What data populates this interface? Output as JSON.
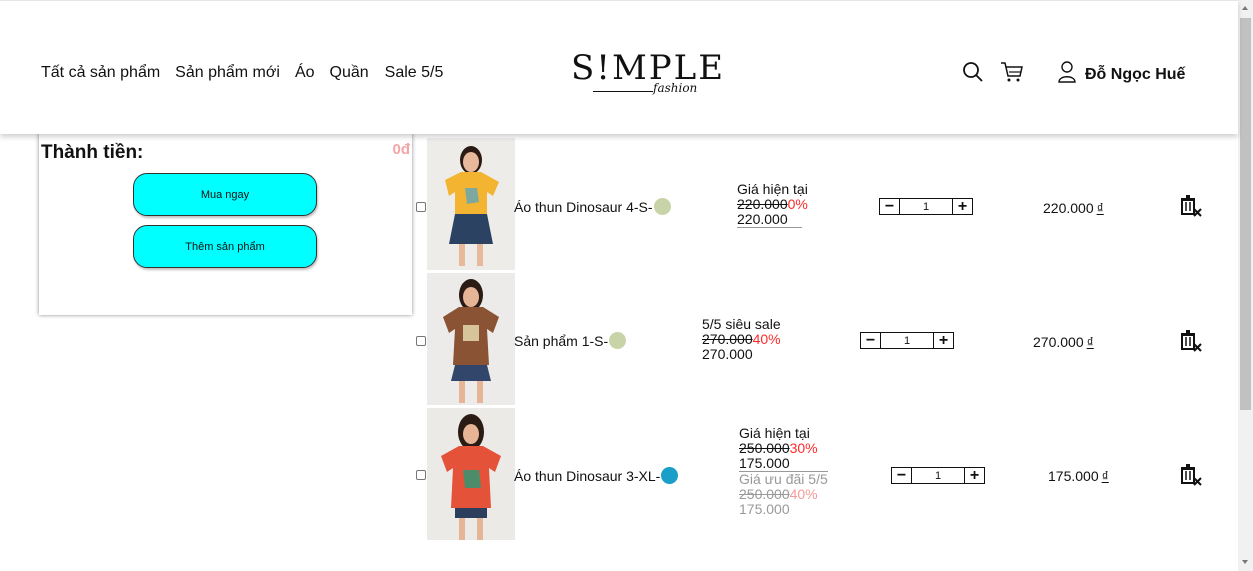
{
  "header": {
    "nav": [
      "Tất cả sản phẩm",
      "Sản phẩm mới",
      "Áo",
      "Quần",
      "Sale 5/5"
    ],
    "logo_main": "S!MPLE",
    "logo_sub": "fashion",
    "user_name": "Đỗ Ngọc Huế",
    "icons": [
      "search-icon",
      "cart-icon",
      "user-icon"
    ]
  },
  "summary": {
    "title": "Thành tiền:",
    "total": "0đ",
    "buy_now": "Mua ngay",
    "add_product": "Thêm sản phẩm"
  },
  "colors": {
    "accent_cyan": "#00ffff",
    "discount_red": "#ff2b2b"
  },
  "items": [
    {
      "name": "Áo thun Dinosaur 4-S-",
      "color_dot": "#c8d4a8",
      "price_label": "Giá hiện tại",
      "old_price": "220.000",
      "discount": "0%",
      "new_price": "220.000",
      "qty": "1",
      "line_total": "220.000",
      "currency": "₫"
    },
    {
      "name": "Sản phẩm 1-S-",
      "color_dot": "#c8d4a8",
      "price_label": "5/5 siêu sale",
      "old_price": "270.000",
      "discount": "40%",
      "new_price": "270.000",
      "qty": "1",
      "line_total": "270.000",
      "currency": "₫"
    },
    {
      "name": "Áo thun Dinosaur 3-XL-",
      "color_dot": "#1a9fc9",
      "price_label": "Giá hiện tại",
      "old_price": "250.000",
      "discount": "30%",
      "new_price": "175.000",
      "promo_label": "Giá ưu đãi 5/5",
      "promo_old_price": "250.000",
      "promo_discount": "40%",
      "promo_new_price": "175.000",
      "qty": "1",
      "line_total": "175.000",
      "currency": "₫"
    }
  ]
}
